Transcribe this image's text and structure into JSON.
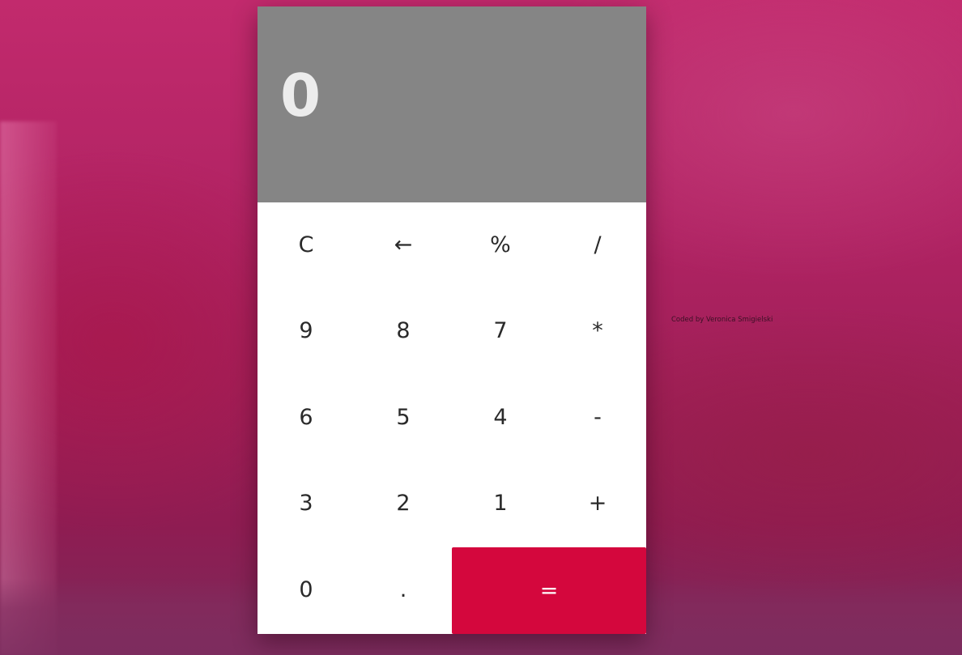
{
  "display": {
    "value": "0"
  },
  "keys": [
    {
      "label": "C",
      "name": "clear-button"
    },
    {
      "label": "←",
      "name": "backspace-button"
    },
    {
      "label": "%",
      "name": "percent-button"
    },
    {
      "label": "/",
      "name": "divide-button"
    },
    {
      "label": "9",
      "name": "digit-9-button"
    },
    {
      "label": "8",
      "name": "digit-8-button"
    },
    {
      "label": "7",
      "name": "digit-7-button"
    },
    {
      "label": "*",
      "name": "multiply-button"
    },
    {
      "label": "6",
      "name": "digit-6-button"
    },
    {
      "label": "5",
      "name": "digit-5-button"
    },
    {
      "label": "4",
      "name": "digit-4-button"
    },
    {
      "label": "-",
      "name": "subtract-button"
    },
    {
      "label": "3",
      "name": "digit-3-button"
    },
    {
      "label": "2",
      "name": "digit-2-button"
    },
    {
      "label": "1",
      "name": "digit-1-button"
    },
    {
      "label": "+",
      "name": "add-button"
    },
    {
      "label": "0",
      "name": "digit-0-button"
    },
    {
      "label": ".",
      "name": "decimal-button"
    },
    {
      "label": "=",
      "name": "equals-button"
    }
  ],
  "credit": {
    "text": "Coded by Veronica Smigielski"
  },
  "colors": {
    "display_background": "#858585",
    "display_text": "#ececec",
    "keypad_background": "#ffffff",
    "equals_background": "#d4073d",
    "page_background": "#b02363"
  }
}
